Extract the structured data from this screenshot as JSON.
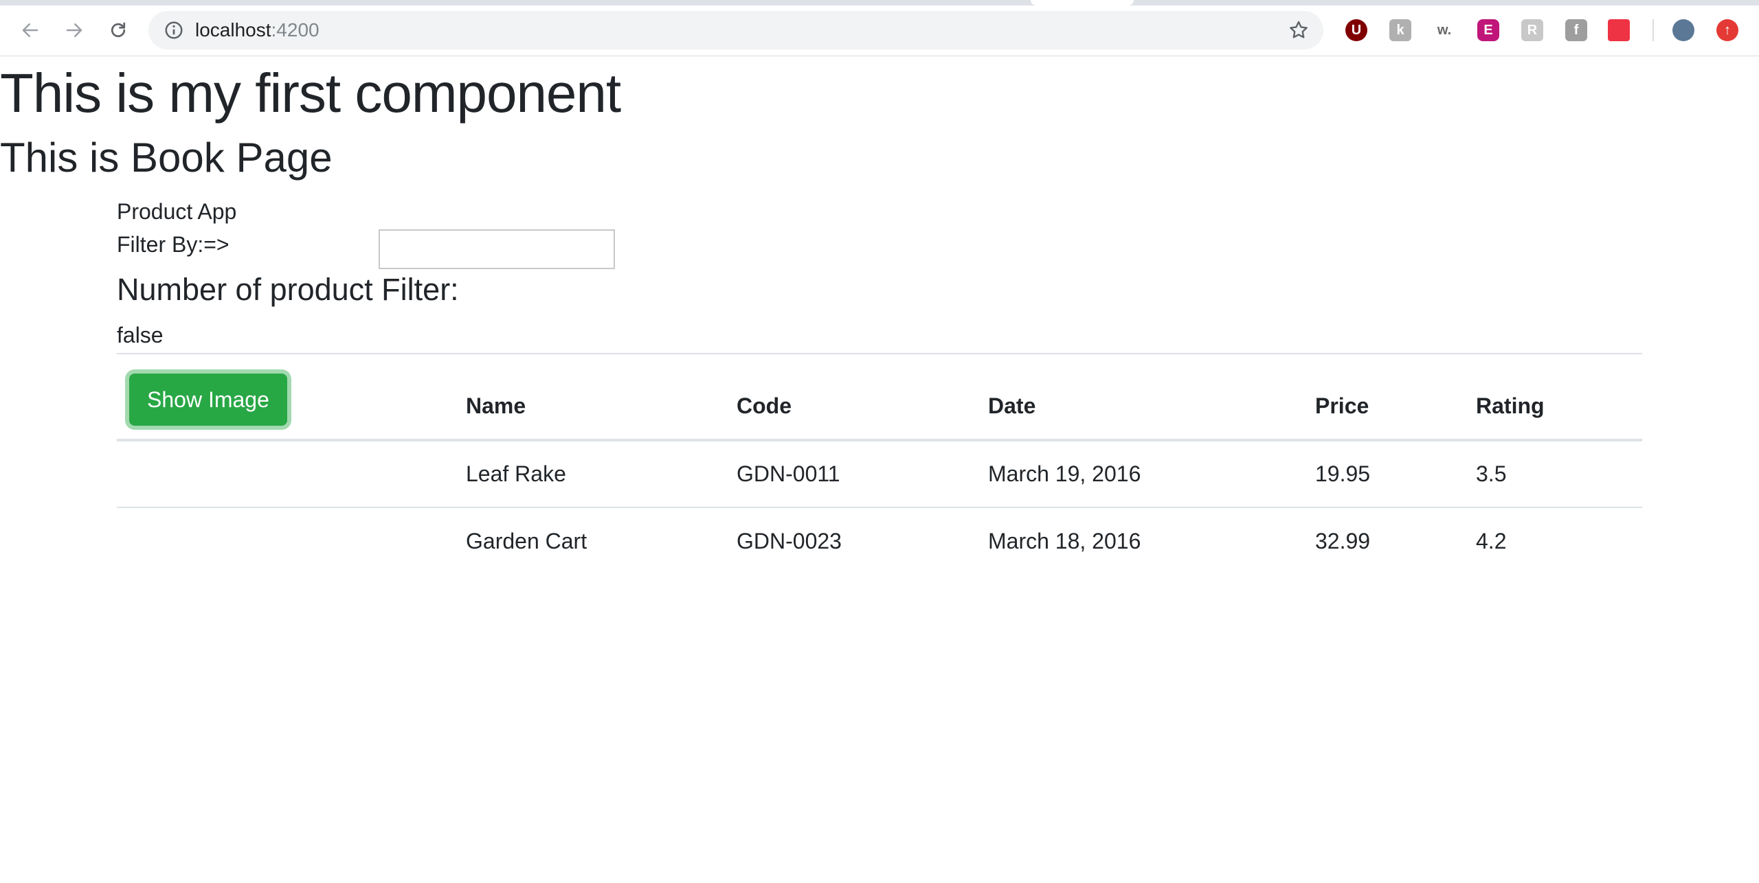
{
  "browser": {
    "url_host": "localhost",
    "url_port": ":4200",
    "extensions": [
      {
        "name": "ublock-origin",
        "glyph": "U",
        "color": "#800000"
      },
      {
        "name": "k-extension",
        "glyph": "k",
        "color": "#b0b0b0"
      },
      {
        "name": "w-extension",
        "glyph": "w.",
        "color": "#666666"
      },
      {
        "name": "e-extension",
        "glyph": "E",
        "color": "#c0167a"
      },
      {
        "name": "r-extension",
        "glyph": "R",
        "color": "#c0c0c0"
      },
      {
        "name": "facebook-extension",
        "glyph": "f",
        "color": "#9e9e9e"
      },
      {
        "name": "stack-extension",
        "glyph": "",
        "color": "#ee3344"
      },
      {
        "name": "upload-extension",
        "glyph": "↑",
        "color": "#e53935"
      }
    ]
  },
  "page": {
    "heading": "This is my first component",
    "subheading": "This is Book Page",
    "app_title": "Product App",
    "filter_label": "Filter By:=>",
    "filter_value": "",
    "filter_heading": "Number of product Filter:",
    "filter_state": "false"
  },
  "table": {
    "show_image_label": "Show Image",
    "columns": [
      "Name",
      "Code",
      "Date",
      "Price",
      "Rating"
    ],
    "rows": [
      {
        "name": "Leaf Rake",
        "code": "GDN-0011",
        "date": "March 19, 2016",
        "price": "19.95",
        "rating": "3.5"
      },
      {
        "name": "Garden Cart",
        "code": "GDN-0023",
        "date": "March 18, 2016",
        "price": "32.99",
        "rating": "4.2"
      }
    ]
  }
}
